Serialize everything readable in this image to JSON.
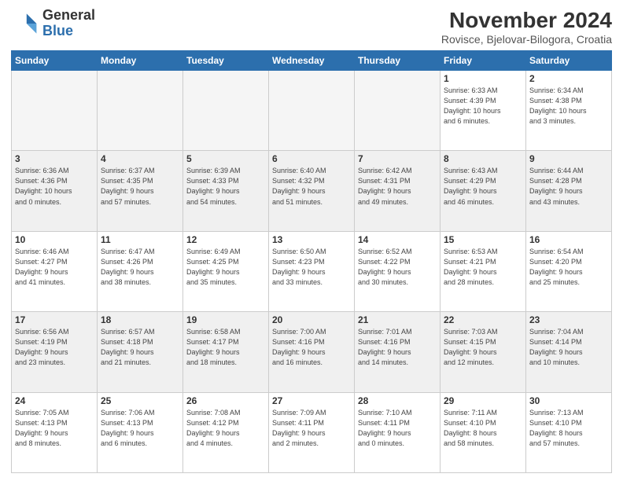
{
  "header": {
    "logo_general": "General",
    "logo_blue": "Blue",
    "title": "November 2024",
    "location": "Rovisce, Bjelovar-Bilogora, Croatia"
  },
  "days_of_week": [
    "Sunday",
    "Monday",
    "Tuesday",
    "Wednesday",
    "Thursday",
    "Friday",
    "Saturday"
  ],
  "weeks": [
    {
      "shaded": false,
      "days": [
        {
          "num": "",
          "info": ""
        },
        {
          "num": "",
          "info": ""
        },
        {
          "num": "",
          "info": ""
        },
        {
          "num": "",
          "info": ""
        },
        {
          "num": "",
          "info": ""
        },
        {
          "num": "1",
          "info": "Sunrise: 6:33 AM\nSunset: 4:39 PM\nDaylight: 10 hours\nand 6 minutes."
        },
        {
          "num": "2",
          "info": "Sunrise: 6:34 AM\nSunset: 4:38 PM\nDaylight: 10 hours\nand 3 minutes."
        }
      ]
    },
    {
      "shaded": true,
      "days": [
        {
          "num": "3",
          "info": "Sunrise: 6:36 AM\nSunset: 4:36 PM\nDaylight: 10 hours\nand 0 minutes."
        },
        {
          "num": "4",
          "info": "Sunrise: 6:37 AM\nSunset: 4:35 PM\nDaylight: 9 hours\nand 57 minutes."
        },
        {
          "num": "5",
          "info": "Sunrise: 6:39 AM\nSunset: 4:33 PM\nDaylight: 9 hours\nand 54 minutes."
        },
        {
          "num": "6",
          "info": "Sunrise: 6:40 AM\nSunset: 4:32 PM\nDaylight: 9 hours\nand 51 minutes."
        },
        {
          "num": "7",
          "info": "Sunrise: 6:42 AM\nSunset: 4:31 PM\nDaylight: 9 hours\nand 49 minutes."
        },
        {
          "num": "8",
          "info": "Sunrise: 6:43 AM\nSunset: 4:29 PM\nDaylight: 9 hours\nand 46 minutes."
        },
        {
          "num": "9",
          "info": "Sunrise: 6:44 AM\nSunset: 4:28 PM\nDaylight: 9 hours\nand 43 minutes."
        }
      ]
    },
    {
      "shaded": false,
      "days": [
        {
          "num": "10",
          "info": "Sunrise: 6:46 AM\nSunset: 4:27 PM\nDaylight: 9 hours\nand 41 minutes."
        },
        {
          "num": "11",
          "info": "Sunrise: 6:47 AM\nSunset: 4:26 PM\nDaylight: 9 hours\nand 38 minutes."
        },
        {
          "num": "12",
          "info": "Sunrise: 6:49 AM\nSunset: 4:25 PM\nDaylight: 9 hours\nand 35 minutes."
        },
        {
          "num": "13",
          "info": "Sunrise: 6:50 AM\nSunset: 4:23 PM\nDaylight: 9 hours\nand 33 minutes."
        },
        {
          "num": "14",
          "info": "Sunrise: 6:52 AM\nSunset: 4:22 PM\nDaylight: 9 hours\nand 30 minutes."
        },
        {
          "num": "15",
          "info": "Sunrise: 6:53 AM\nSunset: 4:21 PM\nDaylight: 9 hours\nand 28 minutes."
        },
        {
          "num": "16",
          "info": "Sunrise: 6:54 AM\nSunset: 4:20 PM\nDaylight: 9 hours\nand 25 minutes."
        }
      ]
    },
    {
      "shaded": true,
      "days": [
        {
          "num": "17",
          "info": "Sunrise: 6:56 AM\nSunset: 4:19 PM\nDaylight: 9 hours\nand 23 minutes."
        },
        {
          "num": "18",
          "info": "Sunrise: 6:57 AM\nSunset: 4:18 PM\nDaylight: 9 hours\nand 21 minutes."
        },
        {
          "num": "19",
          "info": "Sunrise: 6:58 AM\nSunset: 4:17 PM\nDaylight: 9 hours\nand 18 minutes."
        },
        {
          "num": "20",
          "info": "Sunrise: 7:00 AM\nSunset: 4:16 PM\nDaylight: 9 hours\nand 16 minutes."
        },
        {
          "num": "21",
          "info": "Sunrise: 7:01 AM\nSunset: 4:16 PM\nDaylight: 9 hours\nand 14 minutes."
        },
        {
          "num": "22",
          "info": "Sunrise: 7:03 AM\nSunset: 4:15 PM\nDaylight: 9 hours\nand 12 minutes."
        },
        {
          "num": "23",
          "info": "Sunrise: 7:04 AM\nSunset: 4:14 PM\nDaylight: 9 hours\nand 10 minutes."
        }
      ]
    },
    {
      "shaded": false,
      "days": [
        {
          "num": "24",
          "info": "Sunrise: 7:05 AM\nSunset: 4:13 PM\nDaylight: 9 hours\nand 8 minutes."
        },
        {
          "num": "25",
          "info": "Sunrise: 7:06 AM\nSunset: 4:13 PM\nDaylight: 9 hours\nand 6 minutes."
        },
        {
          "num": "26",
          "info": "Sunrise: 7:08 AM\nSunset: 4:12 PM\nDaylight: 9 hours\nand 4 minutes."
        },
        {
          "num": "27",
          "info": "Sunrise: 7:09 AM\nSunset: 4:11 PM\nDaylight: 9 hours\nand 2 minutes."
        },
        {
          "num": "28",
          "info": "Sunrise: 7:10 AM\nSunset: 4:11 PM\nDaylight: 9 hours\nand 0 minutes."
        },
        {
          "num": "29",
          "info": "Sunrise: 7:11 AM\nSunset: 4:10 PM\nDaylight: 8 hours\nand 58 minutes."
        },
        {
          "num": "30",
          "info": "Sunrise: 7:13 AM\nSunset: 4:10 PM\nDaylight: 8 hours\nand 57 minutes."
        }
      ]
    }
  ]
}
